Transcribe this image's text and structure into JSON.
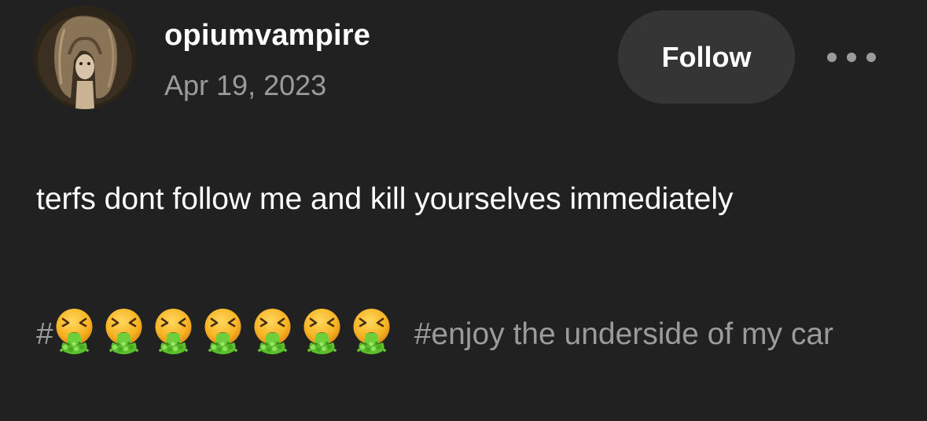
{
  "post": {
    "username": "opiumvampire",
    "date": "Apr 19, 2023",
    "follow_label": "Follow",
    "body_text": "terfs dont follow me and kill yourselves immediately",
    "tags": {
      "first_prefix": "#",
      "first_emoji_count": 7,
      "first_emoji_icon": "face-vomiting-emoji",
      "second": "#enjoy the underside of my car"
    }
  },
  "colors": {
    "background": "#212121",
    "primary_text": "#ffffff",
    "secondary_text": "#9b9b9b",
    "follow_button_bg": "#353535"
  },
  "icons": {
    "more_menu": "ellipsis-icon",
    "avatar": "user-avatar-image"
  }
}
